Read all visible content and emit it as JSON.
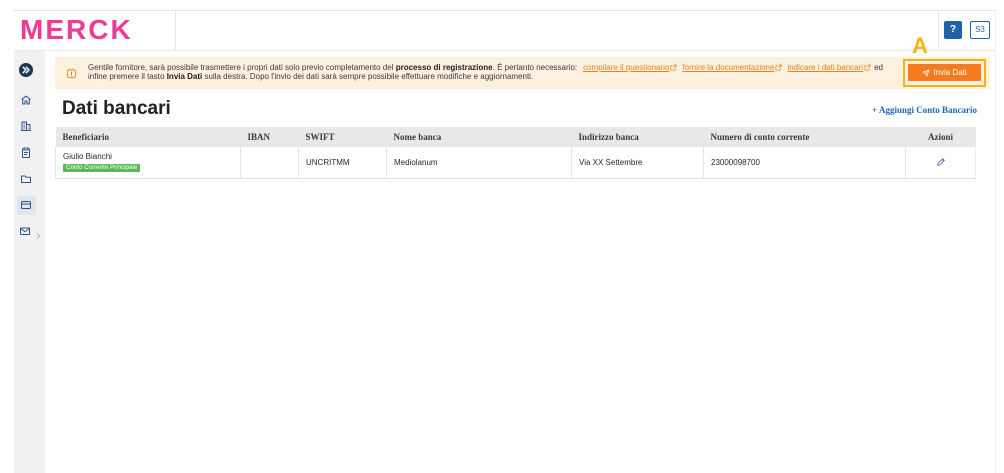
{
  "brand": {
    "logo_text": "MERCK"
  },
  "header": {
    "help_label": "?",
    "user_initials": "S3"
  },
  "sidebar": {
    "items": [
      {
        "icon": "expand-icon"
      },
      {
        "icon": "home-icon"
      },
      {
        "icon": "building-icon"
      },
      {
        "icon": "clipboard-icon"
      },
      {
        "icon": "folder-icon"
      },
      {
        "icon": "bank-card-icon",
        "active": true
      },
      {
        "icon": "mail-icon",
        "submenu": true
      }
    ]
  },
  "notice": {
    "icon": "warning-icon",
    "line1_text": "Gentile fornitore, sarà possibile trasmettere i propri dati solo previo completamento del ",
    "line1_bold": "processo di registrazione",
    "line1_text2": ". È pertanto necessario:",
    "links": [
      "compilare il questionario",
      "fornire la documentazione",
      "indicare i dati bancari"
    ],
    "line1_end": "ed",
    "line2_text": "infine premere il tasto ",
    "line2_bold": "Invia Dati",
    "line2_text2": " sulla destra. Dopo l'invio dei dati sarà sempre possibile effettuare modifiche e aggiornamenti."
  },
  "submit_button": {
    "label": "Invia Dati",
    "icon": "send-icon"
  },
  "annotation": {
    "label": "A"
  },
  "page": {
    "title": "Dati bancari",
    "add_account_label": "+ Aggiungi Conto Bancario"
  },
  "table": {
    "columns": [
      "Beneficiario",
      "IBAN",
      "SWIFT",
      "Nome banca",
      "Indirizzo banca",
      "Numero di conto corrente",
      "Azioni"
    ],
    "rows": [
      {
        "beneficiario": "Giulio Bianchi",
        "badge": "Conto Corrente Principale",
        "iban": "",
        "swift": "UNCRITMM",
        "nome_banca": "Mediolanum",
        "indirizzo_banca": "Via XX Settembre",
        "numero_conto": "23000098700",
        "action_icon": "pencil-icon"
      }
    ]
  },
  "colors": {
    "brand": "#eb3c96",
    "accent": "#f47b20",
    "highlight": "#f3b50a",
    "link": "#1f67b1",
    "success": "#5cb85c",
    "notice_bg": "#fdf0df",
    "primary": "#2361a9",
    "warn": "#e5831f"
  }
}
